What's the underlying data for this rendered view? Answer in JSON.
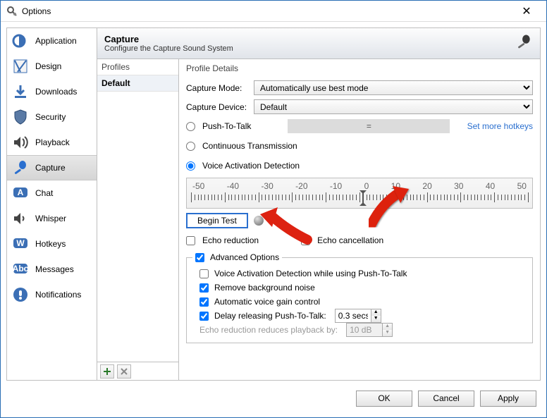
{
  "window": {
    "title": "Options"
  },
  "sidebar": {
    "items": [
      {
        "label": "Application"
      },
      {
        "label": "Design"
      },
      {
        "label": "Downloads"
      },
      {
        "label": "Security"
      },
      {
        "label": "Playback"
      },
      {
        "label": "Capture",
        "selected": true
      },
      {
        "label": "Chat"
      },
      {
        "label": "Whisper"
      },
      {
        "label": "Hotkeys"
      },
      {
        "label": "Messages"
      },
      {
        "label": "Notifications"
      }
    ]
  },
  "header": {
    "title": "Capture",
    "subtitle": "Configure the Capture Sound System"
  },
  "profiles": {
    "heading": "Profiles",
    "items": [
      "Default"
    ]
  },
  "details": {
    "heading": "Profile Details",
    "capture_mode_label": "Capture Mode:",
    "capture_mode_value": "Automatically use best mode",
    "capture_device_label": "Capture Device:",
    "capture_device_value": "Default",
    "ptt_label": "Push-To-Talk",
    "ptt_hotkey": "=",
    "more_hotkeys": "Set more hotkeys",
    "ct_label": "Continuous Transmission",
    "vad_label": "Voice Activation Detection",
    "ruler_labels": [
      "-50",
      "-40",
      "-30",
      "-20",
      "-10",
      "0",
      "10",
      "20",
      "30",
      "40",
      "50"
    ],
    "begin_test": "Begin Test",
    "echo_reduction": "Echo reduction",
    "echo_cancellation": "Echo cancellation",
    "advanced_legend": "Advanced Options",
    "adv_vad_ptt": "Voice Activation Detection while using Push-To-Talk",
    "adv_noise": "Remove background noise",
    "adv_gain": "Automatic voice gain control",
    "adv_delay": "Delay releasing Push-To-Talk:",
    "adv_delay_value": "0.3 secs",
    "adv_echo_reduces": "Echo reduction reduces playback by:",
    "adv_echo_reduces_value": "10 dB"
  },
  "buttons": {
    "ok": "OK",
    "cancel": "Cancel",
    "apply": "Apply"
  }
}
